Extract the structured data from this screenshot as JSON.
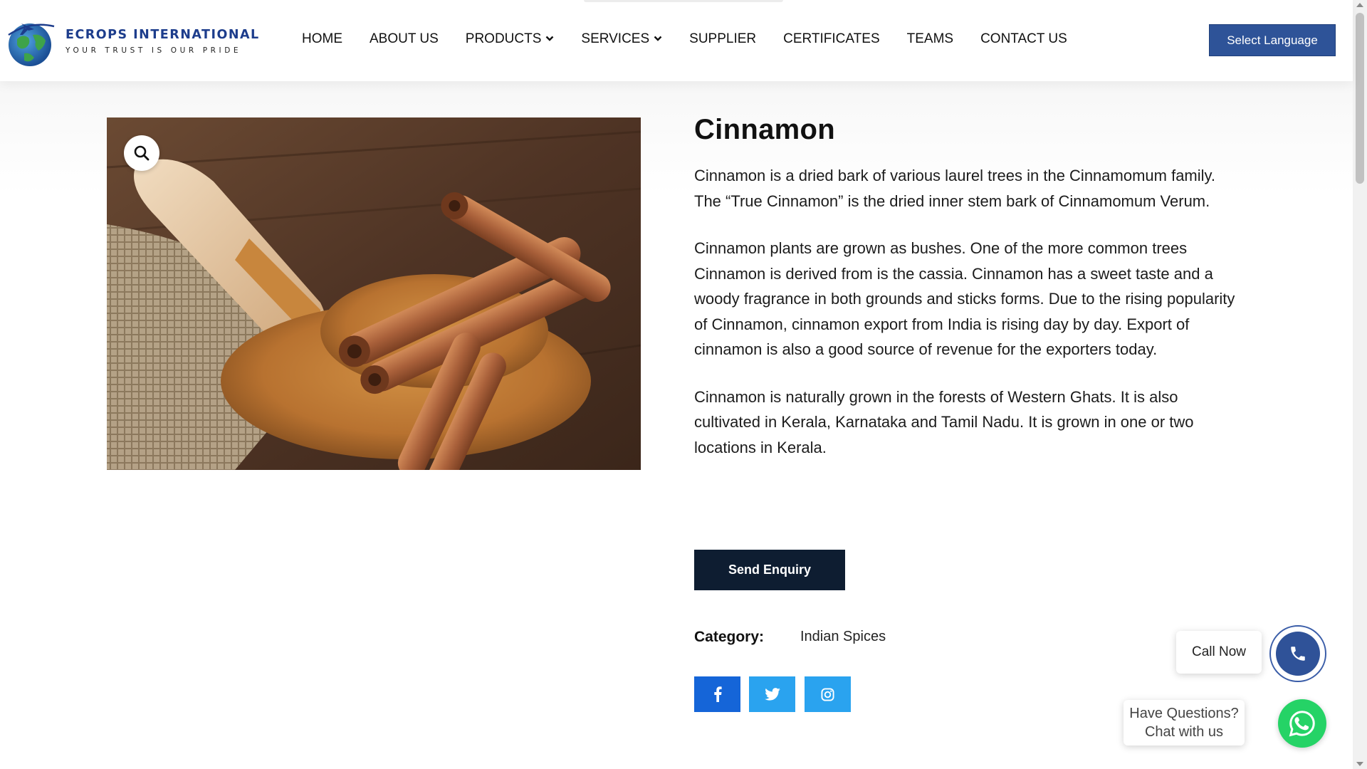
{
  "header": {
    "logo": {
      "name": "ECROPS INTERNATIONAL",
      "tagline": "YOUR TRUST IS OUR PRIDE"
    },
    "nav": [
      {
        "label": "HOME",
        "dropdown": false
      },
      {
        "label": "ABOUT US",
        "dropdown": false
      },
      {
        "label": "PRODUCTS",
        "dropdown": true
      },
      {
        "label": "SERVICES",
        "dropdown": true
      },
      {
        "label": "SUPPLIER",
        "dropdown": false
      },
      {
        "label": "CERTIFICATES",
        "dropdown": false
      },
      {
        "label": "TEAMS",
        "dropdown": false
      },
      {
        "label": "CONTACT US",
        "dropdown": false
      }
    ],
    "language_button": "Select Language"
  },
  "product": {
    "title": "Cinnamon",
    "description": [
      "Cinnamon is a dried bark of various laurel trees in the Cinnamomum family. The “True Cinnamon” is the dried inner stem bark of Cinnamomum Verum.",
      "Cinnamon plants are grown as bushes. One of the more common trees Cinnamon is derived from is the cassia. Cinnamon has a sweet taste and a woody fragrance in both grounds and sticks forms. Due to the rising popularity of Cinnamon, cinnamon export from India is rising day by day. Export of cinnamon is also a good source of revenue for the exporters today.",
      "Cinnamon is naturally grown in the forests of Western Ghats. It is also cultivated in Kerala, Karnataka and Tamil Nadu. It is grown in one or two locations in Kerala."
    ],
    "enquiry_button": "Send Enquiry",
    "category_label": "Category:",
    "category_value": "Indian Spices",
    "zoom_icon": "search-icon",
    "social_icons": [
      "facebook-icon",
      "twitter-icon",
      "instagram-icon"
    ]
  },
  "widgets": {
    "call_now": "Call Now",
    "whatsapp_line1": "Have Questions?",
    "whatsapp_line2": "Chat with us"
  },
  "colors": {
    "brand_blue": "#2e5398",
    "enquiry_dark": "#0e1d31",
    "facebook": "#1565d8",
    "twitter": "#2aa3ef",
    "whatsapp": "#25d366"
  }
}
